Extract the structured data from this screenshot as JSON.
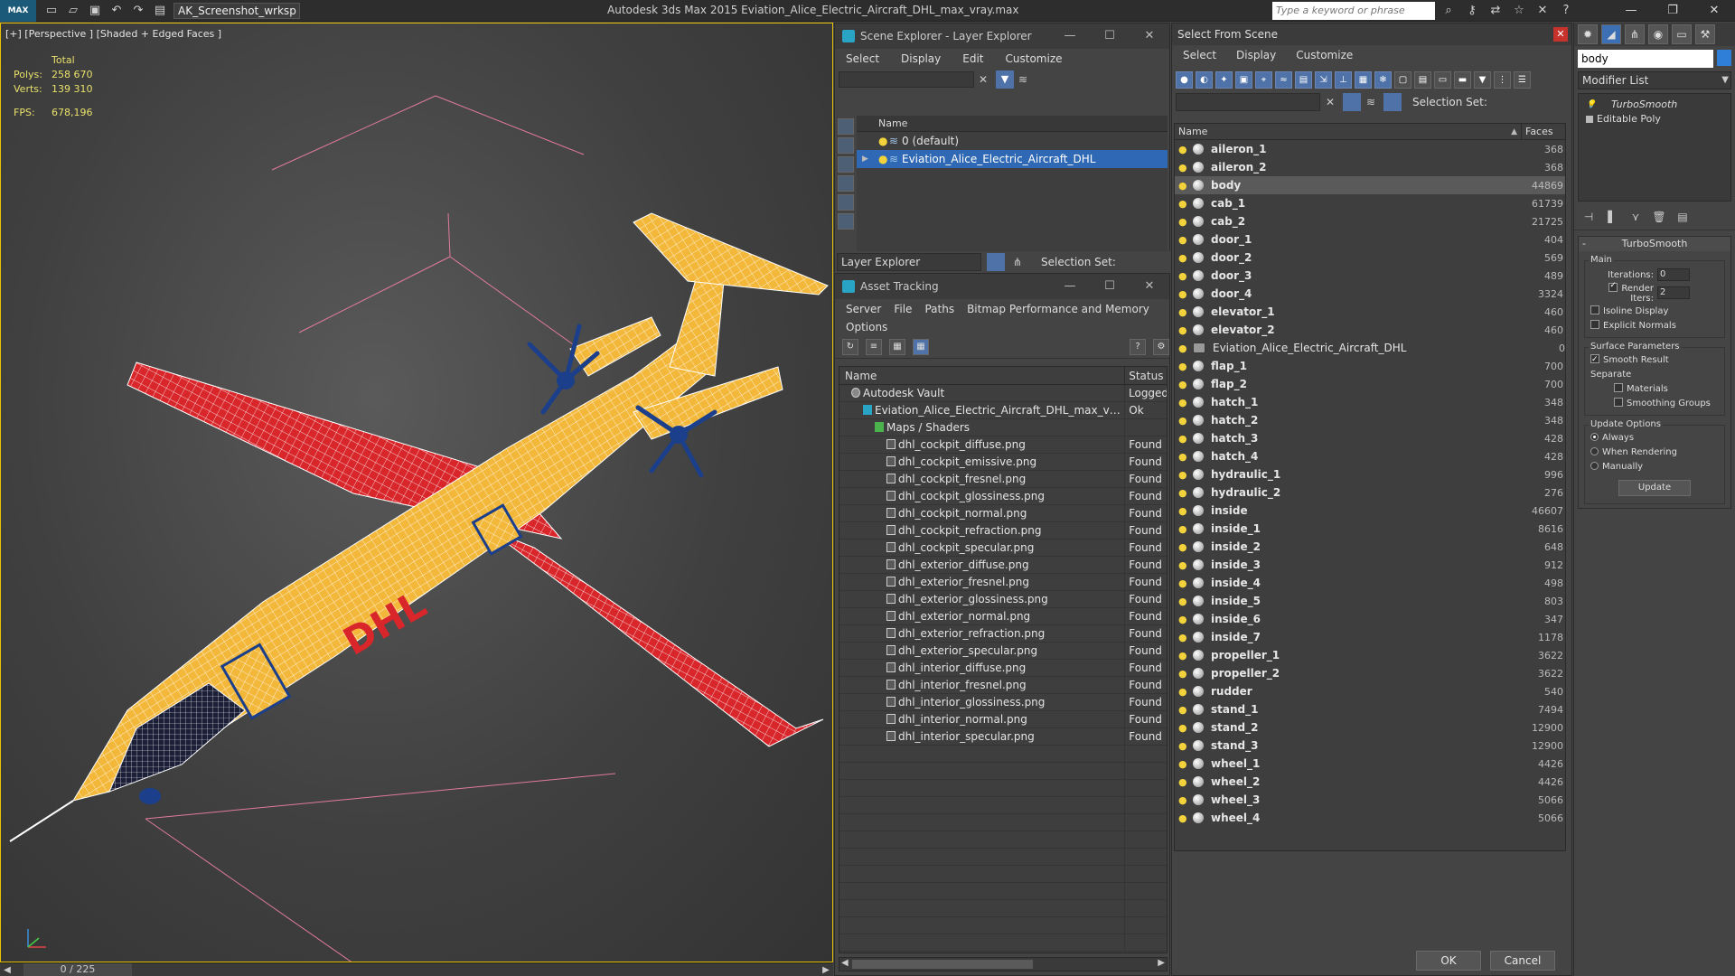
{
  "titlebar": {
    "workspace": "AK_Screenshot_wrksp",
    "title": "Autodesk 3ds Max  2015     Eviation_Alice_Electric_Aircraft_DHL_max_vray.max",
    "search_placeholder": "Type a keyword or phrase"
  },
  "viewport": {
    "label": "[+] [Perspective ] [Shaded + Edged Faces ]",
    "stats": {
      "total_label": "Total",
      "polys_label": "Polys:",
      "polys_value": "258 670",
      "verts_label": "Verts:",
      "verts_value": "139 310",
      "fps_label": "FPS:",
      "fps_value": "678,196"
    },
    "timeline_frame": "0 / 225"
  },
  "scene_explorer": {
    "title": "Scene Explorer - Layer Explorer",
    "menu": [
      "Select",
      "Display",
      "Edit",
      "Customize"
    ],
    "column_name": "Name",
    "layers": [
      "0 (default)",
      "Eviation_Alice_Electric_Aircraft_DHL"
    ],
    "bottom_dropdown": "Layer Explorer",
    "selection_set": "Selection Set:"
  },
  "asset_tracking": {
    "title": "Asset Tracking",
    "menu": [
      "Server",
      "File",
      "Paths",
      "Bitmap Performance and Memory"
    ],
    "menu2": "Options",
    "col_name": "Name",
    "col_status": "Status",
    "rows": [
      {
        "name": "Autodesk Vault",
        "status": "Logged",
        "kind": "vault",
        "indent": 1
      },
      {
        "name": "Eviation_Alice_Electric_Aircraft_DHL_max_vray....",
        "status": "Ok",
        "kind": "max",
        "indent": 2
      },
      {
        "name": "Maps / Shaders",
        "status": "",
        "kind": "maps",
        "indent": 3
      },
      {
        "name": "dhl_cockpit_diffuse.png",
        "status": "Found",
        "kind": "file",
        "indent": 4
      },
      {
        "name": "dhl_cockpit_emissive.png",
        "status": "Found",
        "kind": "file",
        "indent": 4
      },
      {
        "name": "dhl_cockpit_fresnel.png",
        "status": "Found",
        "kind": "file",
        "indent": 4
      },
      {
        "name": "dhl_cockpit_glossiness.png",
        "status": "Found",
        "kind": "file",
        "indent": 4
      },
      {
        "name": "dhl_cockpit_normal.png",
        "status": "Found",
        "kind": "file",
        "indent": 4
      },
      {
        "name": "dhl_cockpit_refraction.png",
        "status": "Found",
        "kind": "file",
        "indent": 4
      },
      {
        "name": "dhl_cockpit_specular.png",
        "status": "Found",
        "kind": "file",
        "indent": 4
      },
      {
        "name": "dhl_exterior_diffuse.png",
        "status": "Found",
        "kind": "file",
        "indent": 4
      },
      {
        "name": "dhl_exterior_fresnel.png",
        "status": "Found",
        "kind": "file",
        "indent": 4
      },
      {
        "name": "dhl_exterior_glossiness.png",
        "status": "Found",
        "kind": "file",
        "indent": 4
      },
      {
        "name": "dhl_exterior_normal.png",
        "status": "Found",
        "kind": "file",
        "indent": 4
      },
      {
        "name": "dhl_exterior_refraction.png",
        "status": "Found",
        "kind": "file",
        "indent": 4
      },
      {
        "name": "dhl_exterior_specular.png",
        "status": "Found",
        "kind": "file",
        "indent": 4
      },
      {
        "name": "dhl_interior_diffuse.png",
        "status": "Found",
        "kind": "file",
        "indent": 4
      },
      {
        "name": "dhl_interior_fresnel.png",
        "status": "Found",
        "kind": "file",
        "indent": 4
      },
      {
        "name": "dhl_interior_glossiness.png",
        "status": "Found",
        "kind": "file",
        "indent": 4
      },
      {
        "name": "dhl_interior_normal.png",
        "status": "Found",
        "kind": "file",
        "indent": 4
      },
      {
        "name": "dhl_interior_specular.png",
        "status": "Found",
        "kind": "file",
        "indent": 4
      }
    ]
  },
  "select_from_scene": {
    "title": "Select From Scene",
    "menu": [
      "Select",
      "Display",
      "Customize"
    ],
    "selection_set": "Selection Set:",
    "col_name": "Name",
    "col_faces": "Faces",
    "rows": [
      {
        "name": "aileron_1",
        "faces": "368"
      },
      {
        "name": "aileron_2",
        "faces": "368"
      },
      {
        "name": "body",
        "faces": "44869",
        "selected": true
      },
      {
        "name": "cab_1",
        "faces": "61739"
      },
      {
        "name": "cab_2",
        "faces": "21725"
      },
      {
        "name": "door_1",
        "faces": "404"
      },
      {
        "name": "door_2",
        "faces": "569"
      },
      {
        "name": "door_3",
        "faces": "489"
      },
      {
        "name": "door_4",
        "faces": "3324"
      },
      {
        "name": "elevator_1",
        "faces": "460"
      },
      {
        "name": "elevator_2",
        "faces": "460"
      },
      {
        "name": "Eviation_Alice_Electric_Aircraft_DHL",
        "faces": "0",
        "group": true
      },
      {
        "name": "flap_1",
        "faces": "700"
      },
      {
        "name": "flap_2",
        "faces": "700"
      },
      {
        "name": "hatch_1",
        "faces": "348"
      },
      {
        "name": "hatch_2",
        "faces": "348"
      },
      {
        "name": "hatch_3",
        "faces": "428"
      },
      {
        "name": "hatch_4",
        "faces": "428"
      },
      {
        "name": "hydraulic_1",
        "faces": "996"
      },
      {
        "name": "hydraulic_2",
        "faces": "276"
      },
      {
        "name": "inside",
        "faces": "46607"
      },
      {
        "name": "inside_1",
        "faces": "8616"
      },
      {
        "name": "inside_2",
        "faces": "648"
      },
      {
        "name": "inside_3",
        "faces": "912"
      },
      {
        "name": "inside_4",
        "faces": "498"
      },
      {
        "name": "inside_5",
        "faces": "803"
      },
      {
        "name": "inside_6",
        "faces": "347"
      },
      {
        "name": "inside_7",
        "faces": "1178"
      },
      {
        "name": "propeller_1",
        "faces": "3622"
      },
      {
        "name": "propeller_2",
        "faces": "3622"
      },
      {
        "name": "rudder",
        "faces": "540"
      },
      {
        "name": "stand_1",
        "faces": "7494"
      },
      {
        "name": "stand_2",
        "faces": "12900"
      },
      {
        "name": "stand_3",
        "faces": "12900"
      },
      {
        "name": "wheel_1",
        "faces": "4426"
      },
      {
        "name": "wheel_2",
        "faces": "4426"
      },
      {
        "name": "wheel_3",
        "faces": "5066"
      },
      {
        "name": "wheel_4",
        "faces": "5066"
      }
    ],
    "ok_label": "OK",
    "cancel_label": "Cancel"
  },
  "command_panel": {
    "object_name": "body",
    "modifier_list": "Modifier List",
    "stack": [
      "TurboSmooth",
      "Editable Poly"
    ],
    "rollout_title": "TurboSmooth",
    "main_group": "Main",
    "iterations_label": "Iterations:",
    "iterations_value": "0",
    "render_iters_label": "Render Iters:",
    "render_iters_value": "2",
    "isoline_label": "Isoline Display",
    "explicit_normals_label": "Explicit Normals",
    "surface_group": "Surface Parameters",
    "smooth_result_label": "Smooth Result",
    "separate_label": "Separate",
    "materials_label": "Materials",
    "smoothing_groups_label": "Smoothing Groups",
    "update_group": "Update Options",
    "always_label": "Always",
    "when_rendering_label": "When Rendering",
    "manually_label": "Manually",
    "update_button": "Update"
  },
  "colors": {
    "accent": "#2f69b5",
    "fuselage": "#f3b83a",
    "wing": "#d8262b",
    "wire": "#ffffff"
  }
}
